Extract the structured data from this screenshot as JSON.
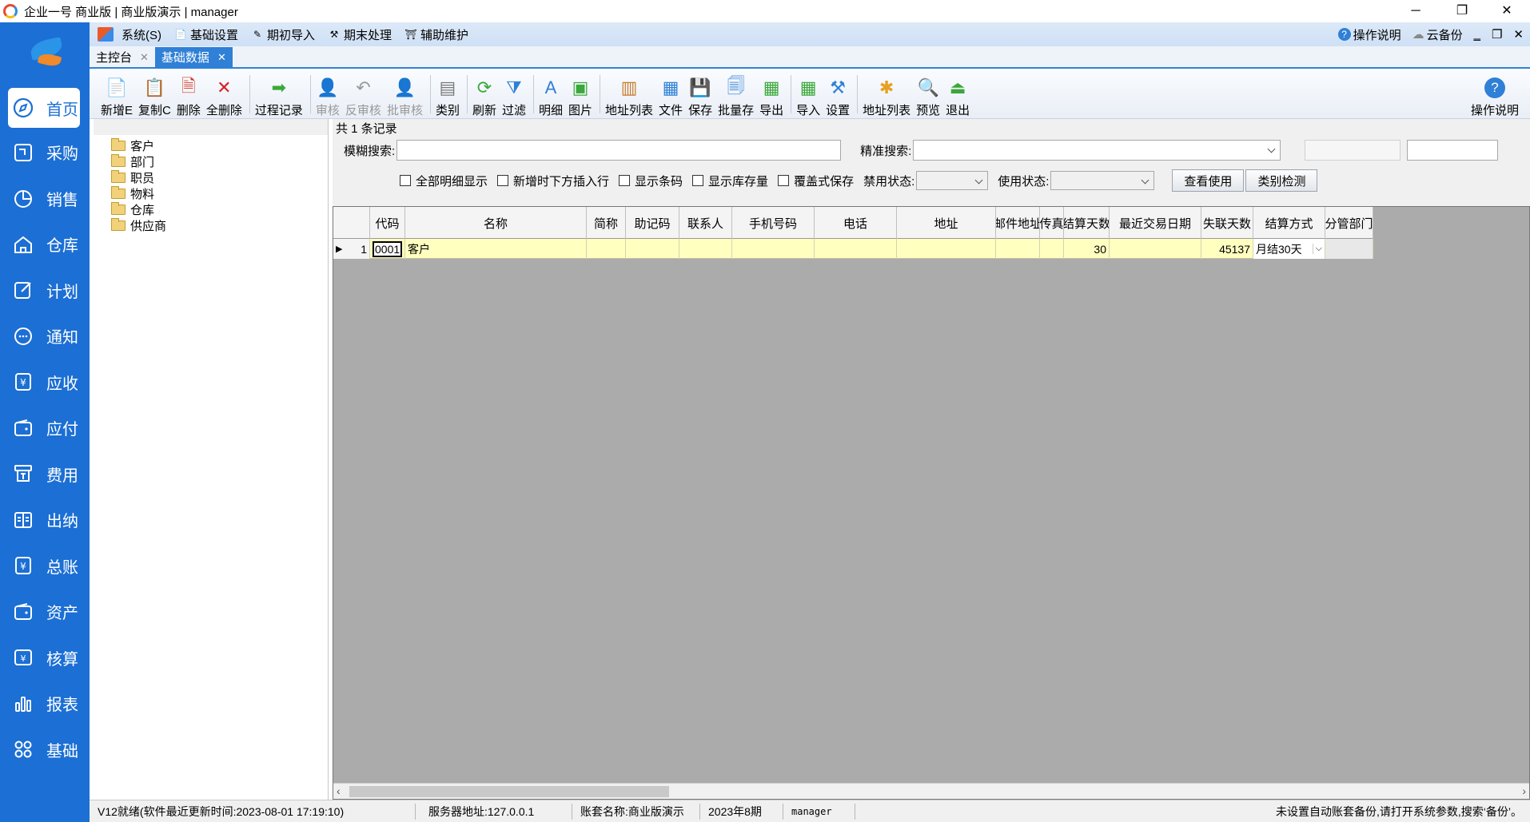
{
  "window": {
    "title": "企业一号 商业版 | 商业版演示 | manager",
    "minimize": "─",
    "restore": "❐",
    "close": "✕"
  },
  "nav": {
    "items": [
      {
        "label": "首页",
        "icon": "home-icon"
      },
      {
        "label": "采购",
        "icon": "purchase-icon"
      },
      {
        "label": "销售",
        "icon": "pie-chart-icon"
      },
      {
        "label": "仓库",
        "icon": "warehouse-icon"
      },
      {
        "label": "计划",
        "icon": "edit-icon"
      },
      {
        "label": "通知",
        "icon": "chat-icon"
      },
      {
        "label": "应收",
        "icon": "yuan-receivable-icon"
      },
      {
        "label": "应付",
        "icon": "wallet-icon"
      },
      {
        "label": "费用",
        "icon": "expense-icon"
      },
      {
        "label": "出纳",
        "icon": "book-icon"
      },
      {
        "label": "总账",
        "icon": "yuan-ledger-icon"
      },
      {
        "label": "资产",
        "icon": "asset-wallet-icon"
      },
      {
        "label": "核算",
        "icon": "accounting-icon"
      },
      {
        "label": "报表",
        "icon": "bar-chart-icon"
      },
      {
        "label": "基础",
        "icon": "grid-icon"
      }
    ]
  },
  "menubar": {
    "items": [
      "系统(S)",
      "基础设置",
      "期初导入",
      "期末处理",
      "辅助维护"
    ],
    "help": "操作说明",
    "cloud_backup": "云备份",
    "min": "‗",
    "restore": "❐",
    "close": "✕"
  },
  "tabs": [
    {
      "label": "主控台",
      "close": "✕"
    },
    {
      "label": "基础数据",
      "close": "✕"
    }
  ],
  "toolbar": {
    "buttons": [
      "新增E",
      "复制C",
      "删除",
      "全删除",
      "过程记录",
      "审核",
      "反审核",
      "批审核",
      "类别",
      "刷新",
      "过滤",
      "明细",
      "图片",
      "地址列表",
      "文件",
      "保存",
      "批量存",
      "导出",
      "导入",
      "设置",
      "地址列表",
      "预览",
      "退出"
    ],
    "help": "操作说明"
  },
  "tree": {
    "nodes": [
      "客户",
      "部门",
      "职员",
      "物料",
      "仓库",
      "供应商"
    ]
  },
  "main": {
    "record_count": "共 1 条记录",
    "fuzzy_label": "模糊搜索:",
    "fuzzy_value": "",
    "exact_label": "精准搜索:",
    "exact_value": "",
    "checkboxes": [
      "全部明细显示",
      "新增时下方插入行",
      "显示条码",
      "显示库存量",
      "覆盖式保存"
    ],
    "disable_status_label": "禁用状态:",
    "use_status_label": "使用状态:",
    "view_usage_button": "查看使用",
    "category_check_button": "类别检测"
  },
  "grid": {
    "columns": [
      "代码",
      "名称",
      "简称",
      "助记码",
      "联系人",
      "手机号码",
      "电话",
      "地址",
      "邮件地址",
      "传真",
      "结算天数",
      "最近交易日期",
      "失联天数",
      "结算方式",
      "分管部门"
    ],
    "rows": [
      {
        "row_no": "1",
        "cells": [
          "0001",
          "客户",
          "",
          "",
          "",
          "",
          "",
          "",
          "",
          "",
          "30",
          "",
          "45137",
          "月结30天",
          ""
        ]
      }
    ]
  },
  "statusbar": {
    "ready": "V12就绪(软件最近更新时间:2023-08-01 17:19:10)",
    "server": "服务器地址:127.0.0.1",
    "account": "账套名称:商业版演示",
    "period": "2023年8期",
    "user": "manager",
    "notice": "未设置自动账套备份,请打开系统参数,搜索‘备份’。"
  },
  "colors": {
    "nav_bg": "#1c6fd4",
    "row_highlight": "#ffffc0",
    "grid_empty": "#ababab",
    "active_tab": "#2f80d6"
  }
}
